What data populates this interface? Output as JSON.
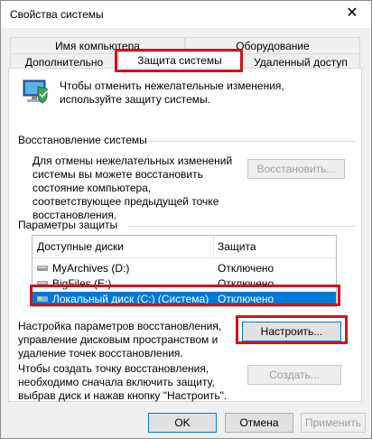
{
  "window": {
    "title": "Свойства системы"
  },
  "tabs": {
    "computer_name": "Имя компьютера",
    "hardware": "Оборудование",
    "advanced": "Дополнительно",
    "system_protection": "Защита системы",
    "remote_access": "Удаленный доступ"
  },
  "intro": {
    "text": "Чтобы отменить нежелательные изменения, используйте защиту системы."
  },
  "restore": {
    "title": "Восстановление системы",
    "description": "Для отмены нежелательных изменений системы вы можете восстановить состояние компьютера, соответствующее предыдущей точке восстановления.",
    "button": "Восстановить..."
  },
  "protection": {
    "title": "Параметры защиты",
    "columns": [
      "Доступные диски",
      "Защита"
    ],
    "drives": [
      {
        "name": "MyArchives (D:)",
        "status": "Отключено"
      },
      {
        "name": "BigFiles (E:)",
        "status": "Отключено"
      },
      {
        "name": "Локальный диск (C:) (Система)",
        "status": "Отключено"
      }
    ]
  },
  "configure": {
    "description": "Настройка параметров восстановления, управление дисковым пространством и удаление точек восстановления.",
    "button": "Настроить..."
  },
  "create": {
    "description": "Чтобы создать точку восстановления, необходимо сначала включить защиту, выбрав диск и нажав кнопку \"Настроить\".",
    "button": "Создать..."
  },
  "footer": {
    "ok": "OK",
    "cancel": "Отмена",
    "apply": "Применить"
  },
  "colors": {
    "highlight": "#d0131d",
    "selection": "#0078d7"
  }
}
